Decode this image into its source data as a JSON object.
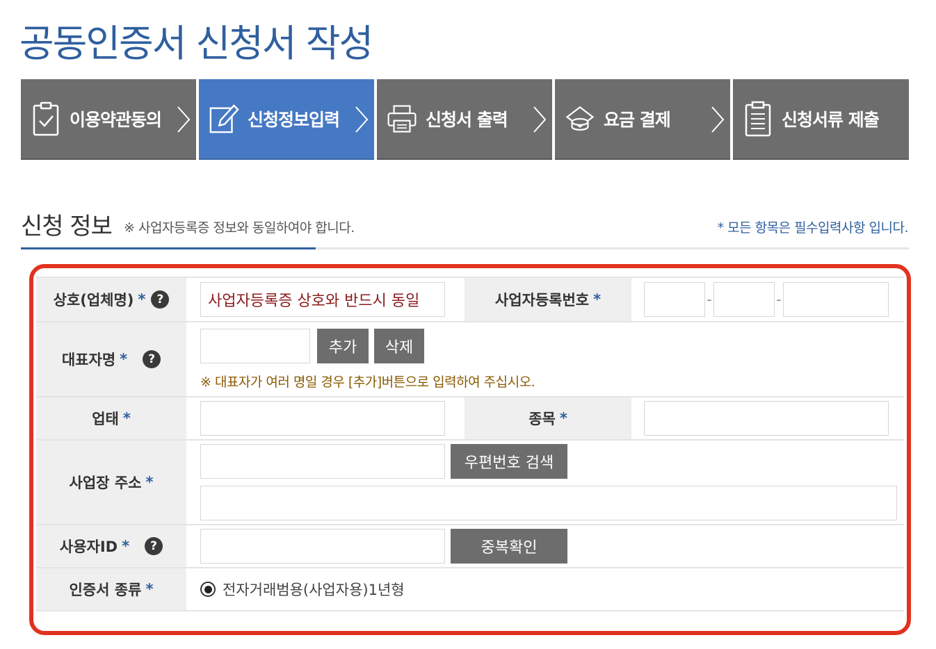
{
  "title": "공동인증서 신청서 작성",
  "steps": [
    {
      "label": "이용약관동의",
      "icon": "checklist-icon",
      "active": false
    },
    {
      "label": "신청정보입력",
      "icon": "pencil-icon",
      "active": true
    },
    {
      "label": "신청서 출력",
      "icon": "printer-icon",
      "active": false
    },
    {
      "label": "요금 결제",
      "icon": "coins-icon",
      "active": false
    },
    {
      "label": "신청서류 제출",
      "icon": "document-icon",
      "active": false
    }
  ],
  "section": {
    "title": "신청 정보",
    "note": "※ 사업자등록증 정보와 동일하여야 합니다.",
    "required_note": "* 모든 항목은 필수입력사항 입니다."
  },
  "form": {
    "company_name": {
      "label": "상호(업체명)",
      "required": "*",
      "help": "?",
      "value": "사업자등록증 상호와 반드시 동일"
    },
    "business_number": {
      "label": "사업자등록번호",
      "required": "*",
      "dash": "-"
    },
    "representative": {
      "label": "대표자명",
      "required": "*",
      "help": "?",
      "add_label": "추가",
      "delete_label": "삭제",
      "hint": "※ 대표자가 여러 명일 경우 [추가]버튼으로 입력하여 주십시오."
    },
    "business_type": {
      "label": "업태",
      "required": "*"
    },
    "business_item": {
      "label": "종목",
      "required": "*"
    },
    "address": {
      "label": "사업장 주소",
      "required": "*",
      "search_label": "우편번호 검색"
    },
    "user_id": {
      "label": "사용자ID",
      "required": "*",
      "help": "?",
      "check_label": "중복확인"
    },
    "cert_type": {
      "label": "인증서 종류",
      "required": "*",
      "option": "전자거래범용(사업자용)1년형"
    }
  },
  "colors": {
    "accent": "#4679c4",
    "title": "#2f5f9e",
    "step_bg": "#6d6d6d",
    "highlight": "#e2321f"
  }
}
